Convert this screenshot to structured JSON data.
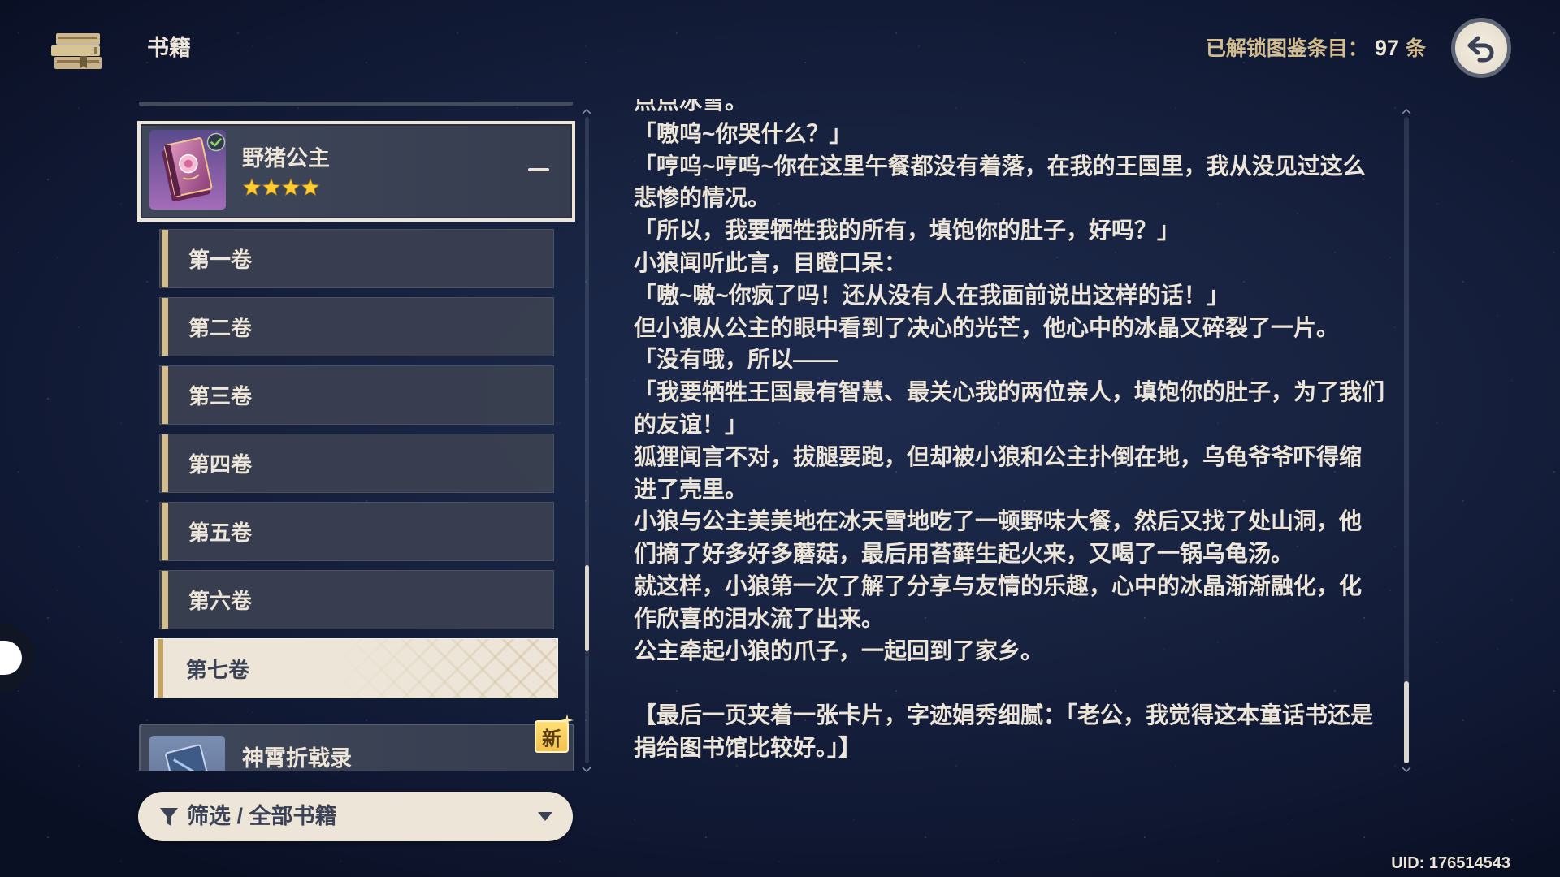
{
  "header": {
    "title": "书籍",
    "unlocked_label": "已解锁图鉴条目：",
    "unlocked_count": "97",
    "unlocked_unit": "条"
  },
  "book_list": {
    "selected_book": {
      "title": "野猪公主",
      "rarity_stars": 4,
      "expanded": true,
      "volumes": [
        "第一卷",
        "第二卷",
        "第三卷",
        "第四卷",
        "第五卷",
        "第六卷",
        "第七卷"
      ],
      "selected_volume_index": 6
    },
    "next_book": {
      "title": "神霄折戟录",
      "badge": "新"
    }
  },
  "filter": {
    "label": "筛选 / 全部书籍"
  },
  "reader": {
    "lines": [
      "点点冰雪。",
      "「嗷呜~你哭什么？」",
      "「哼呜~哼呜~你在这里午餐都没有着落，在我的王国里，我从没见过这么",
      "悲惨的情况。",
      "「所以，我要牺牲我的所有，填饱你的肚子，好吗？」",
      "小狼闻听此言，目瞪口呆：",
      "「嗷~嗷~你疯了吗！还从没有人在我面前说出这样的话！」",
      "但小狼从公主的眼中看到了决心的光芒，他心中的冰晶又碎裂了一片。",
      "「没有哦，所以——",
      "「我要牺牲王国最有智慧、最关心我的两位亲人，填饱你的肚子，为了我们",
      "的友谊！」",
      "狐狸闻言不对，拔腿要跑，但却被小狼和公主扑倒在地，乌龟爷爷吓得缩",
      "进了壳里。",
      "小狼与公主美美地在冰天雪地吃了一顿野味大餐，然后又找了处山洞，他",
      "们摘了好多好多蘑菇，最后用苔藓生起火来，又喝了一锅乌龟汤。",
      "就这样，小狼第一次了解了分享与友情的乐趣，心中的冰晶渐渐融化，化",
      "作欣喜的泪水流了出来。",
      "公主牵起小狼的爪子，一起回到了家乡。",
      "",
      "【最后一页夹着一张卡片，字迹娟秀细腻：「老公，我觉得这本童话书还是",
      "捐给图书馆比较好。」】"
    ]
  },
  "footer": {
    "uid": "UID: 176514543"
  },
  "icons": {
    "header": "books-stack-icon",
    "back": "back-arrow-icon",
    "read_mark": "check-badge-icon",
    "collapse": "minus-icon",
    "rating": "star-icon",
    "filter": "funnel-icon",
    "dropdown": "chevron-down-icon",
    "new_sparkle": "sparkle-icon"
  },
  "colors": {
    "text_cream": "#ece5d8",
    "accent_gold": "#d3bc8e",
    "star_gold": "#ffcc32",
    "panel_dark": "#3b4255",
    "new_badge_gold": "#f2c14e"
  }
}
